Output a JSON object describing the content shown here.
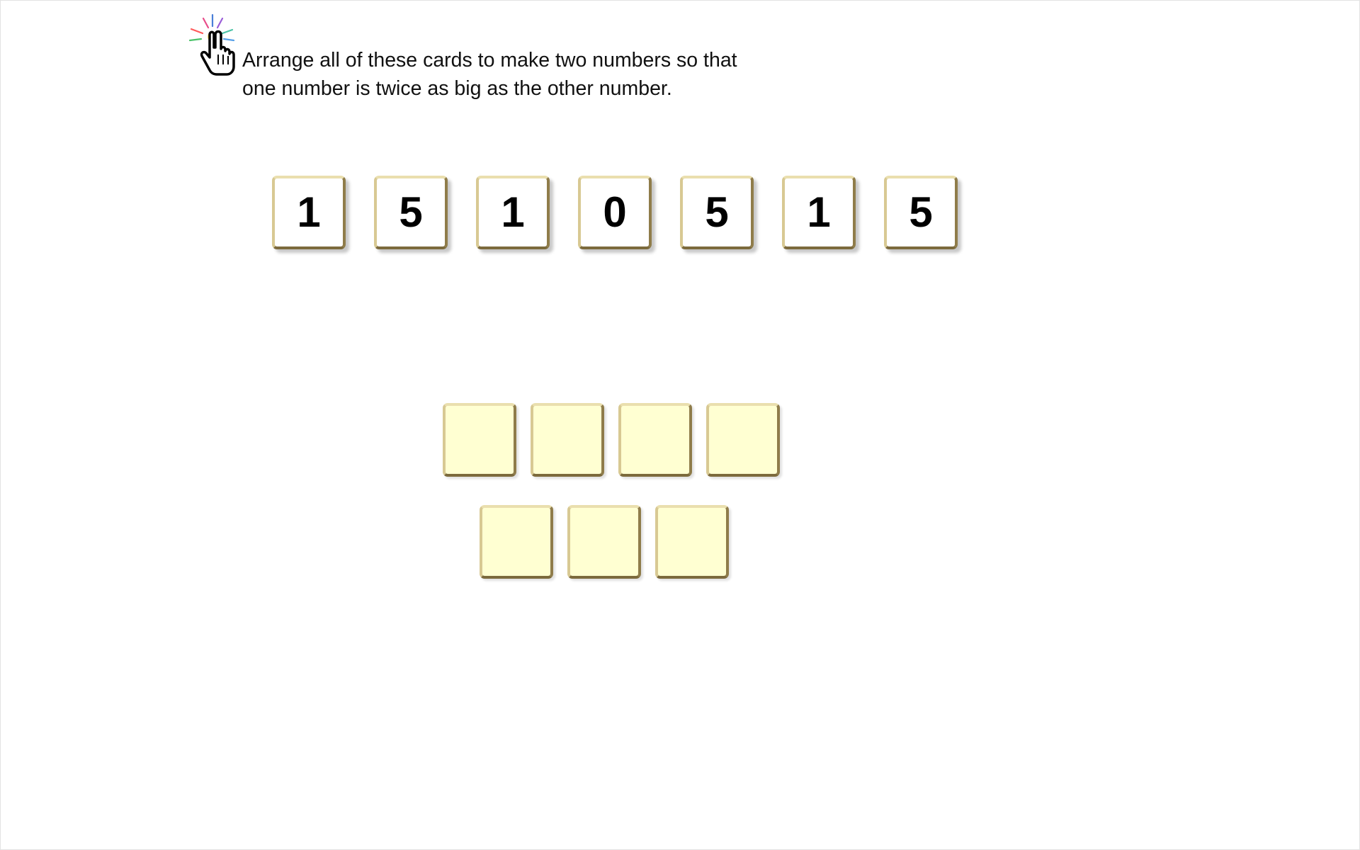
{
  "instruction": {
    "line1": "Arrange all of these cards to make two numbers so that",
    "line2": "one number is twice as big as the other number."
  },
  "icons": {
    "pointer": "hand-pointer-click-icon"
  },
  "cards": [
    "1",
    "5",
    "1",
    "0",
    "5",
    "1",
    "5"
  ],
  "slots": {
    "row1_count": 4,
    "row2_count": 3
  },
  "colors": {
    "card_face": "#ffffff",
    "slot_fill": "#ffffd2",
    "frame_gold": "#b8a56a"
  }
}
